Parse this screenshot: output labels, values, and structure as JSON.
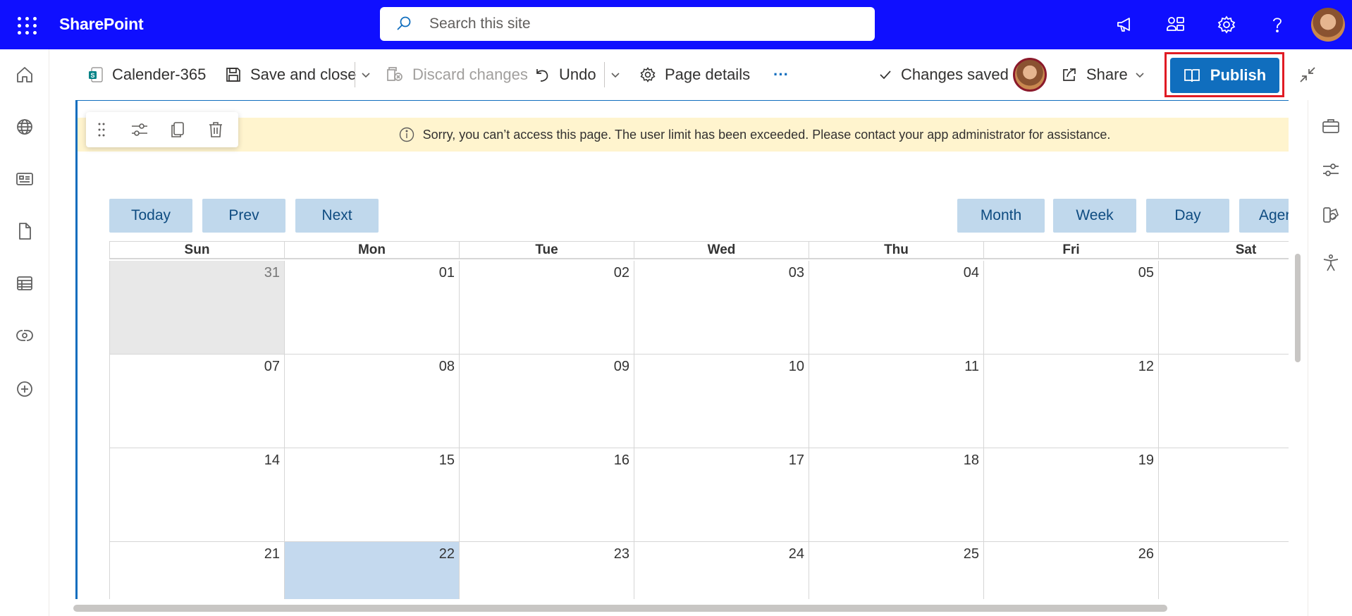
{
  "suite_bar": {
    "app_name": "SharePoint",
    "search": {
      "placeholder": "Search this site",
      "value": ""
    },
    "icons": [
      "app-launcher-icon",
      "megaphone-icon",
      "people-network-icon",
      "gear-icon",
      "help-icon"
    ],
    "background_color": "#0f0fff"
  },
  "left_nav": {
    "items": [
      "home-icon",
      "globe-icon",
      "news-icon",
      "document-icon",
      "list-icon",
      "loop-icon",
      "add-icon"
    ]
  },
  "command_bar": {
    "page_name": "Calender-365",
    "save_and_close": "Save and close",
    "discard_changes": "Discard changes",
    "undo": "Undo",
    "page_details": "Page details",
    "more": "···",
    "status": "Changes saved",
    "share": "Share",
    "publish": "Publish",
    "accent_color": "#106ebe",
    "highlight_color": "#e01b24"
  },
  "banner": {
    "message": "Sorry, you can’t access this page. The user limit has been exceeded. Please contact your app administrator for assistance."
  },
  "calendar": {
    "nav_buttons": [
      "Today",
      "Prev",
      "Next"
    ],
    "view_buttons": [
      "Month",
      "Week",
      "Day",
      "Agenda"
    ],
    "day_headers": [
      "Sun",
      "Mon",
      "Tue",
      "Wed",
      "Thu",
      "Fri",
      "Sat"
    ],
    "weeks": [
      [
        "31",
        "01",
        "02",
        "03",
        "04",
        "05",
        ""
      ],
      [
        "07",
        "08",
        "09",
        "10",
        "11",
        "12",
        ""
      ],
      [
        "14",
        "15",
        "16",
        "17",
        "18",
        "19",
        ""
      ],
      [
        "21",
        "22",
        "23",
        "24",
        "25",
        "26",
        ""
      ]
    ],
    "other_month_day": "31",
    "today": "22",
    "today_color": "#c4d9ee"
  }
}
